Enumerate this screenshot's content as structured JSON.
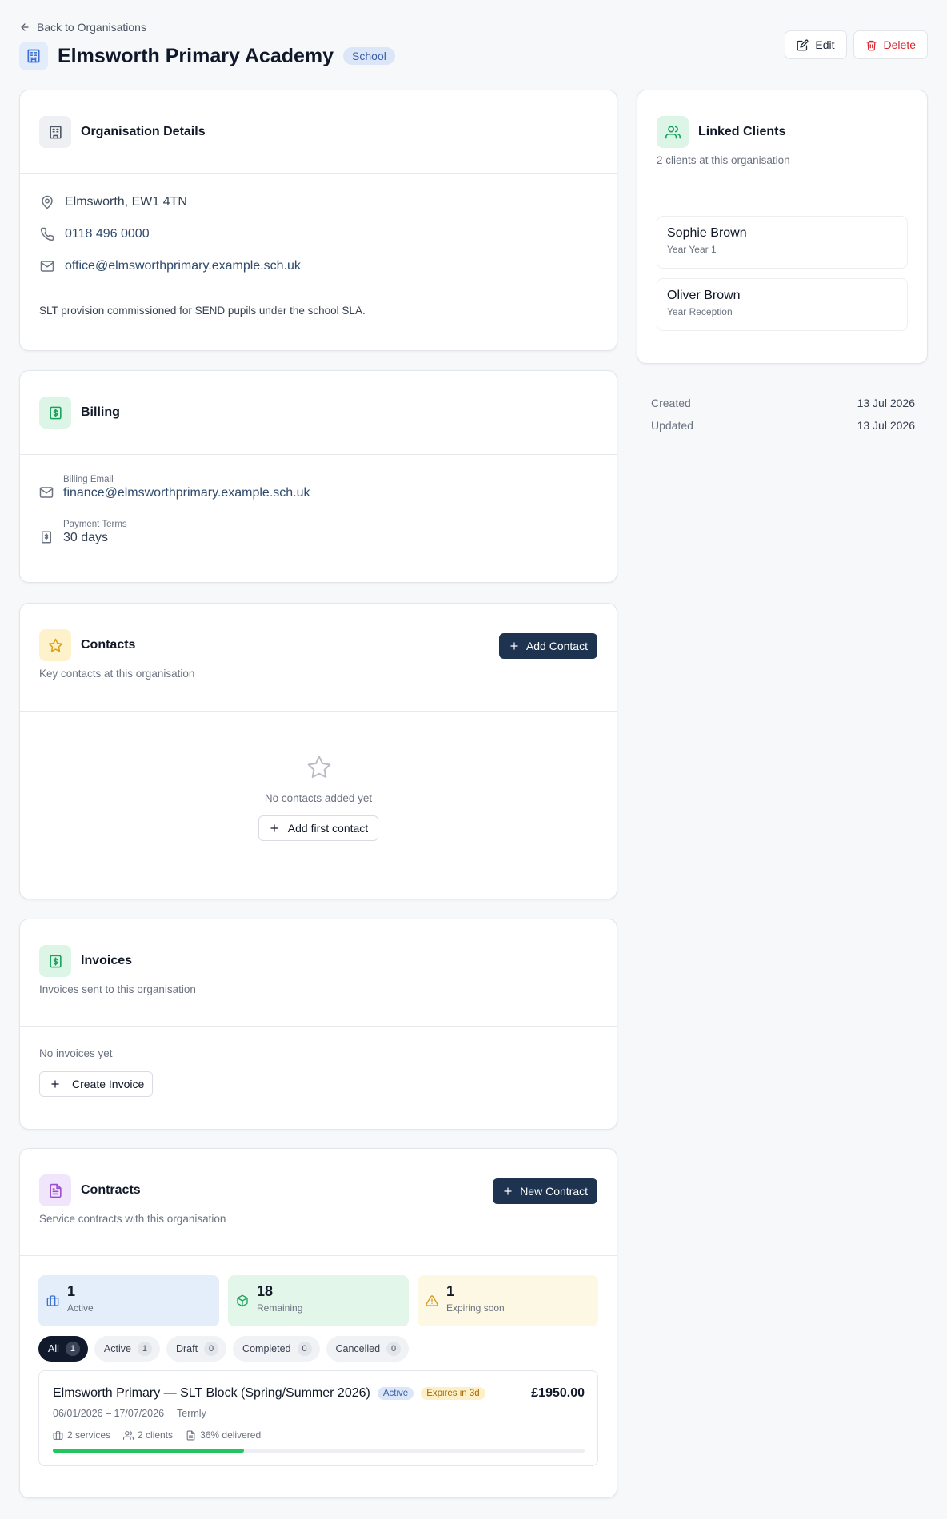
{
  "header": {
    "back_label": "Back to Organisations",
    "title": "Elmsworth Primary Academy",
    "type_badge": "School",
    "edit_label": "Edit",
    "delete_label": "Delete"
  },
  "details": {
    "title": "Organisation Details",
    "address": "Elmsworth, EW1 4TN",
    "phone": "0118 496 0000",
    "email": "office@elmsworthprimary.example.sch.uk",
    "notes": "SLT provision commissioned for SEND pupils under the school SLA."
  },
  "billing": {
    "title": "Billing",
    "email_label": "Billing Email",
    "email": "finance@elmsworthprimary.example.sch.uk",
    "terms_label": "Payment Terms",
    "terms": "30 days"
  },
  "contacts": {
    "title": "Contacts",
    "subtitle": "Key contacts at this organisation",
    "add_label": "Add Contact",
    "empty_text": "No contacts added yet",
    "add_first_label": "Add first contact"
  },
  "invoices": {
    "title": "Invoices",
    "subtitle": "Invoices sent to this organisation",
    "empty_text": "No invoices yet",
    "create_label": "Create Invoice"
  },
  "contracts": {
    "title": "Contracts",
    "subtitle": "Service contracts with this organisation",
    "new_label": "New Contract",
    "stats": [
      {
        "value": "1",
        "label": "Active"
      },
      {
        "value": "18",
        "label": "Remaining"
      },
      {
        "value": "1",
        "label": "Expiring soon"
      }
    ],
    "tabs": [
      {
        "label": "All",
        "count": "1"
      },
      {
        "label": "Active",
        "count": "1"
      },
      {
        "label": "Draft",
        "count": "0"
      },
      {
        "label": "Completed",
        "count": "0"
      },
      {
        "label": "Cancelled",
        "count": "0"
      }
    ],
    "item": {
      "title": "Elmsworth Primary — SLT Block (Spring/Summer 2026)",
      "status": "Active",
      "expiry": "Expires in 3d",
      "amount": "£1950.00",
      "dates": "06/01/2026 – 17/07/2026",
      "frequency": "Termly",
      "services": "2 services",
      "clients": "2 clients",
      "delivered": "36% delivered",
      "progress": 0.36
    }
  },
  "linked_clients": {
    "title": "Linked Clients",
    "subtitle": "2 clients at this organisation",
    "clients": [
      {
        "name": "Sophie Brown",
        "year": "Year Year 1"
      },
      {
        "name": "Oliver Brown",
        "year": "Year Reception"
      }
    ]
  },
  "meta": {
    "created_label": "Created",
    "created": "13 Jul 2026",
    "updated_label": "Updated",
    "updated": "13 Jul 2026"
  },
  "colors": {
    "primary_button": "#1d3350",
    "progress_fill": "#22c55e",
    "delete": "#d7262e"
  }
}
